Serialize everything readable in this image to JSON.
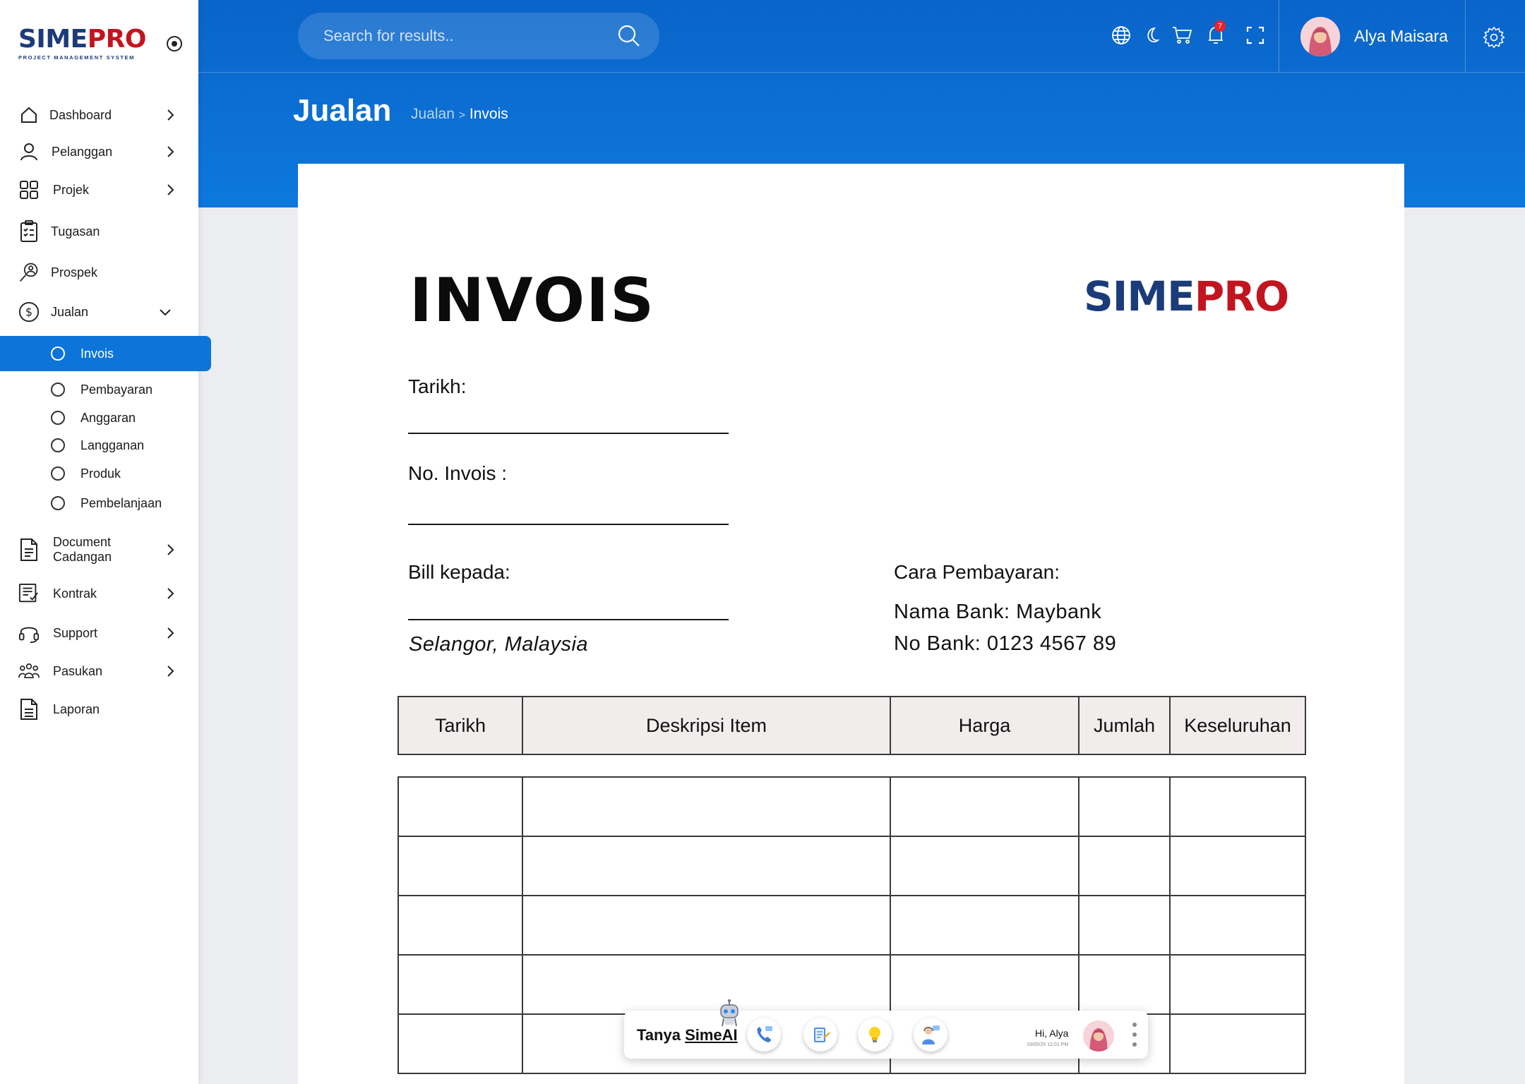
{
  "brand": {
    "part1": "SIME",
    "part2": "PRO",
    "tagline": "PROJECT MANAGEMENT SYSTEM"
  },
  "sidebar": {
    "items": [
      {
        "label": "Dashboard",
        "icon": "home-icon",
        "has_chevron": true
      },
      {
        "label": "Pelanggan",
        "icon": "user-icon",
        "has_chevron": true
      },
      {
        "label": "Projek",
        "icon": "grid-icon",
        "has_chevron": true
      },
      {
        "label": "Tugasan",
        "icon": "clipboard-icon",
        "has_chevron": false
      },
      {
        "label": "Prospek",
        "icon": "prospect-search-icon",
        "has_chevron": false
      },
      {
        "label": "Jualan",
        "icon": "dollar-icon",
        "has_chevron": true,
        "expanded": true
      },
      {
        "label": "Document Cadangan",
        "icon": "document-icon",
        "has_chevron": true
      },
      {
        "label": "Kontrak",
        "icon": "contract-icon",
        "has_chevron": true
      },
      {
        "label": "Support",
        "icon": "headset-icon",
        "has_chevron": true
      },
      {
        "label": "Pasukan",
        "icon": "team-icon",
        "has_chevron": true
      },
      {
        "label": "Laporan",
        "icon": "report-icon",
        "has_chevron": false
      }
    ],
    "sub_items": [
      {
        "label": "Invois",
        "active": true
      },
      {
        "label": "Pembayaran",
        "active": false
      },
      {
        "label": "Anggaran",
        "active": false
      },
      {
        "label": "Langganan",
        "active": false
      },
      {
        "label": "Produk",
        "active": false
      },
      {
        "label": "Pembelanjaan",
        "active": false
      }
    ]
  },
  "header": {
    "search_placeholder": "Search for results..",
    "notification_count": "7",
    "user_name": "Alya Maisara",
    "icons": [
      "globe-icon",
      "moon-icon",
      "cart-icon",
      "bell-icon",
      "fullscreen-icon",
      "gear-icon"
    ]
  },
  "page": {
    "title": "Jualan",
    "breadcrumb": {
      "parent": "Jualan",
      "separator": ">",
      "current": "Invois"
    }
  },
  "invoice": {
    "title": "INVOIS",
    "logo": {
      "part1": "SIME",
      "part2": "PRO"
    },
    "date_label": "Tarikh:",
    "number_label": "No. Invois :",
    "bill_to_label": "Bill kepada:",
    "bill_to_location": "Selangor, Malaysia",
    "payment_label": "Cara Pembayaran:",
    "bank_name": "Nama Bank: Maybank",
    "bank_number": "No Bank: 0123 4567 89",
    "table": {
      "headers": [
        "Tarikh",
        "Deskripsi Item",
        "Harga",
        "Jumlah",
        "Keseluruhan"
      ],
      "empty_rows": 6
    }
  },
  "chat": {
    "ask_prefix": "Tanya ",
    "ask_brand": "SimeAI",
    "greeting": "Hi, Alya",
    "timestamp": "19/05/25 12:01 PM",
    "tools": [
      "phone-icon",
      "notes-icon",
      "lightbulb-icon",
      "support-agent-icon"
    ]
  },
  "colors": {
    "primary": "#0d74d9",
    "header_top": "#0a64c9",
    "brand_navy": "#1b3c79",
    "brand_red": "#c2151f",
    "table_header_bg": "#f0edec",
    "badge": "#e3262f"
  }
}
